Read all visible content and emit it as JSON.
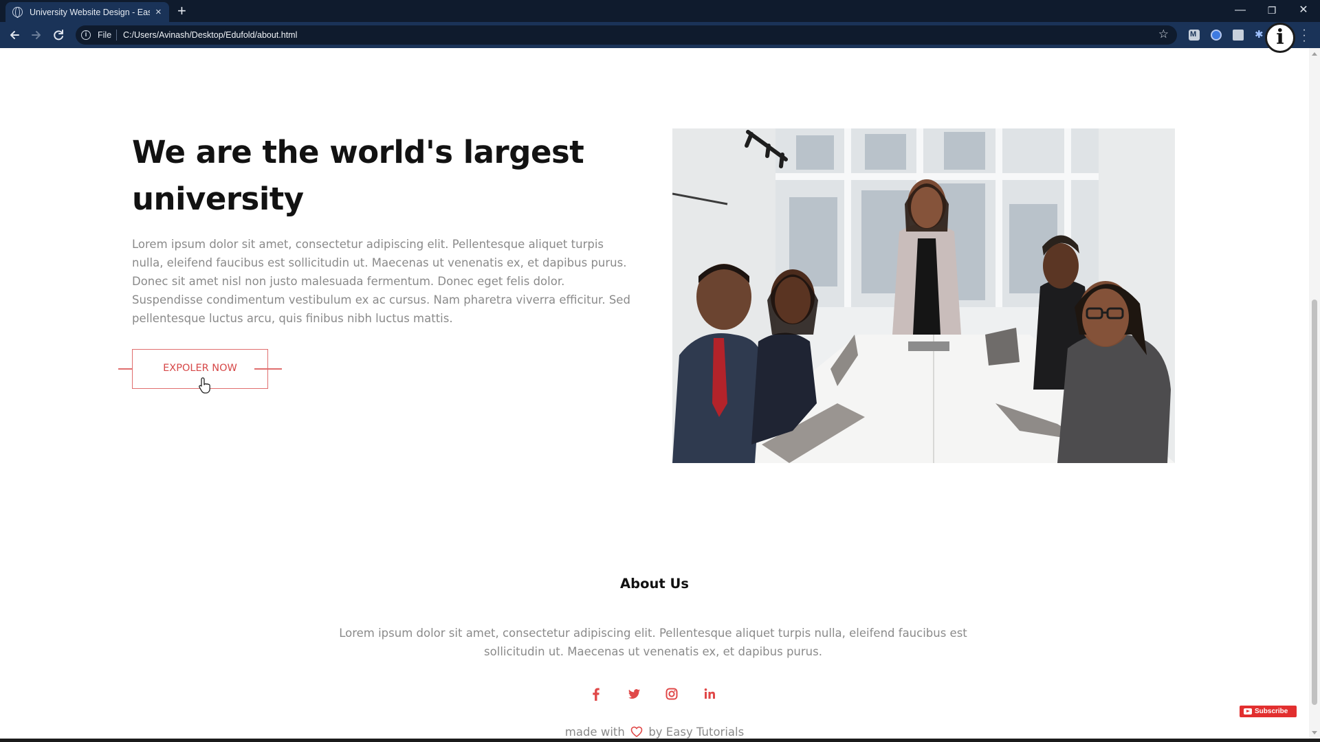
{
  "browser": {
    "tab_title": "University Website Design - Easy",
    "tab_close": "×",
    "new_tab": "+",
    "omnibox_security": "File",
    "url": "C:/Users/Avinash/Desktop/Edufold/about.html",
    "window_controls": {
      "minimize": "—",
      "restore": "❐",
      "close": "✕"
    },
    "profile_icon": "i",
    "icons": [
      "back-arrow-icon",
      "forward-arrow-icon",
      "reload-icon",
      "info-icon",
      "star-icon",
      "extension-icon",
      "kebab-menu-icon"
    ]
  },
  "hero": {
    "headline_line1": "We are the world's largest",
    "headline_line2": "university",
    "paragraph": "Lorem ipsum dolor sit amet, consectetur adipiscing elit. Pellentesque aliquet turpis nulla, eleifend faucibus est sollicitudin ut. Maecenas ut venenatis ex, et dapibus purus. Donec sit amet nisl non justo malesuada fermentum. Donec eget felis dolor. Suspendisse condimentum vestibulum ex ac cursus. Nam pharetra viverra efficitur. Sed pellentesque luctus arcu, quis finibus nibh luctus mattis.",
    "button_label": "EXPOLER NOW",
    "image_subject": "team meeting photo"
  },
  "about": {
    "title": "About Us",
    "text": "Lorem ipsum dolor sit amet, consectetur adipiscing elit. Pellentesque aliquet turpis nulla, eleifend faucibus est sollicitudin ut. Maecenas ut venenatis ex, et dapibus purus."
  },
  "social": [
    {
      "name": "facebook-icon",
      "glyph": "f"
    },
    {
      "name": "twitter-icon",
      "glyph": "twitter"
    },
    {
      "name": "instagram-icon",
      "glyph": "instagram"
    },
    {
      "name": "linkedin-icon",
      "glyph": "in"
    }
  ],
  "footer": {
    "made_with": "made with",
    "by": "by Easy Tutorials"
  },
  "overlay": {
    "subscribe": "Subscribe"
  },
  "colors": {
    "accent": "#e04848",
    "browser_frame": "#0f1b2d",
    "browser_toolbar": "#1a3358",
    "body_text": "#8a8a8a",
    "heading": "#121212"
  }
}
